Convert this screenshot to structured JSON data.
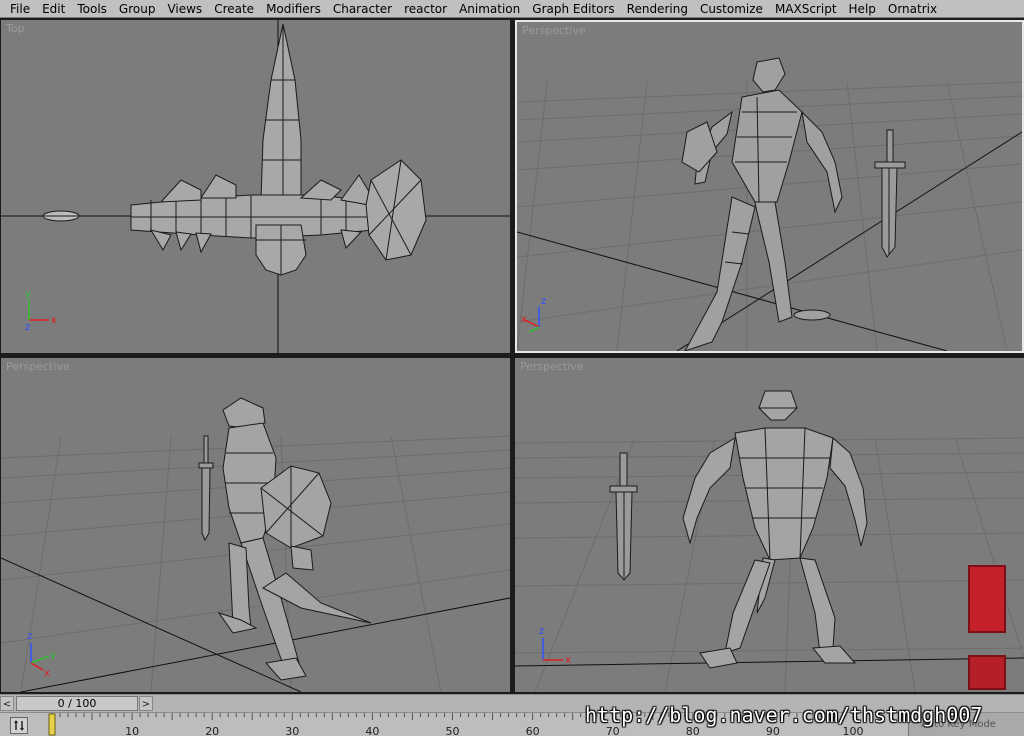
{
  "menu": {
    "items": [
      "File",
      "Edit",
      "Tools",
      "Group",
      "Views",
      "Create",
      "Modifiers",
      "Character",
      "reactor",
      "Animation",
      "Graph Editors",
      "Rendering",
      "Customize",
      "MAXScript",
      "Help",
      "Ornatrix"
    ]
  },
  "viewports": {
    "top_left": {
      "label": "Top"
    },
    "top_right": {
      "label": "Perspective"
    },
    "bottom_left": {
      "label": "Perspective"
    },
    "bottom_right": {
      "label": "Perspective"
    }
  },
  "axes": {
    "x": "x",
    "y": "y",
    "z": "z"
  },
  "timeslider": {
    "prev": "<",
    "next": ">",
    "frame_display": "0 / 100"
  },
  "trackbar": {
    "ticks": [
      "10",
      "20",
      "30",
      "40",
      "50",
      "60",
      "70",
      "80",
      "90",
      "100"
    ],
    "status": "Auto Key Mode"
  },
  "watermark": "http://blog.naver.com/thstmdgh007",
  "colors": {
    "viewport_bg": "#7c7c7c",
    "wire": "#1a1a1a",
    "mesh_fill": "#a8a8a8",
    "axis_x": "#e02020",
    "axis_y": "#30c030",
    "axis_z": "#3050ff",
    "seal": "#c4212a"
  }
}
